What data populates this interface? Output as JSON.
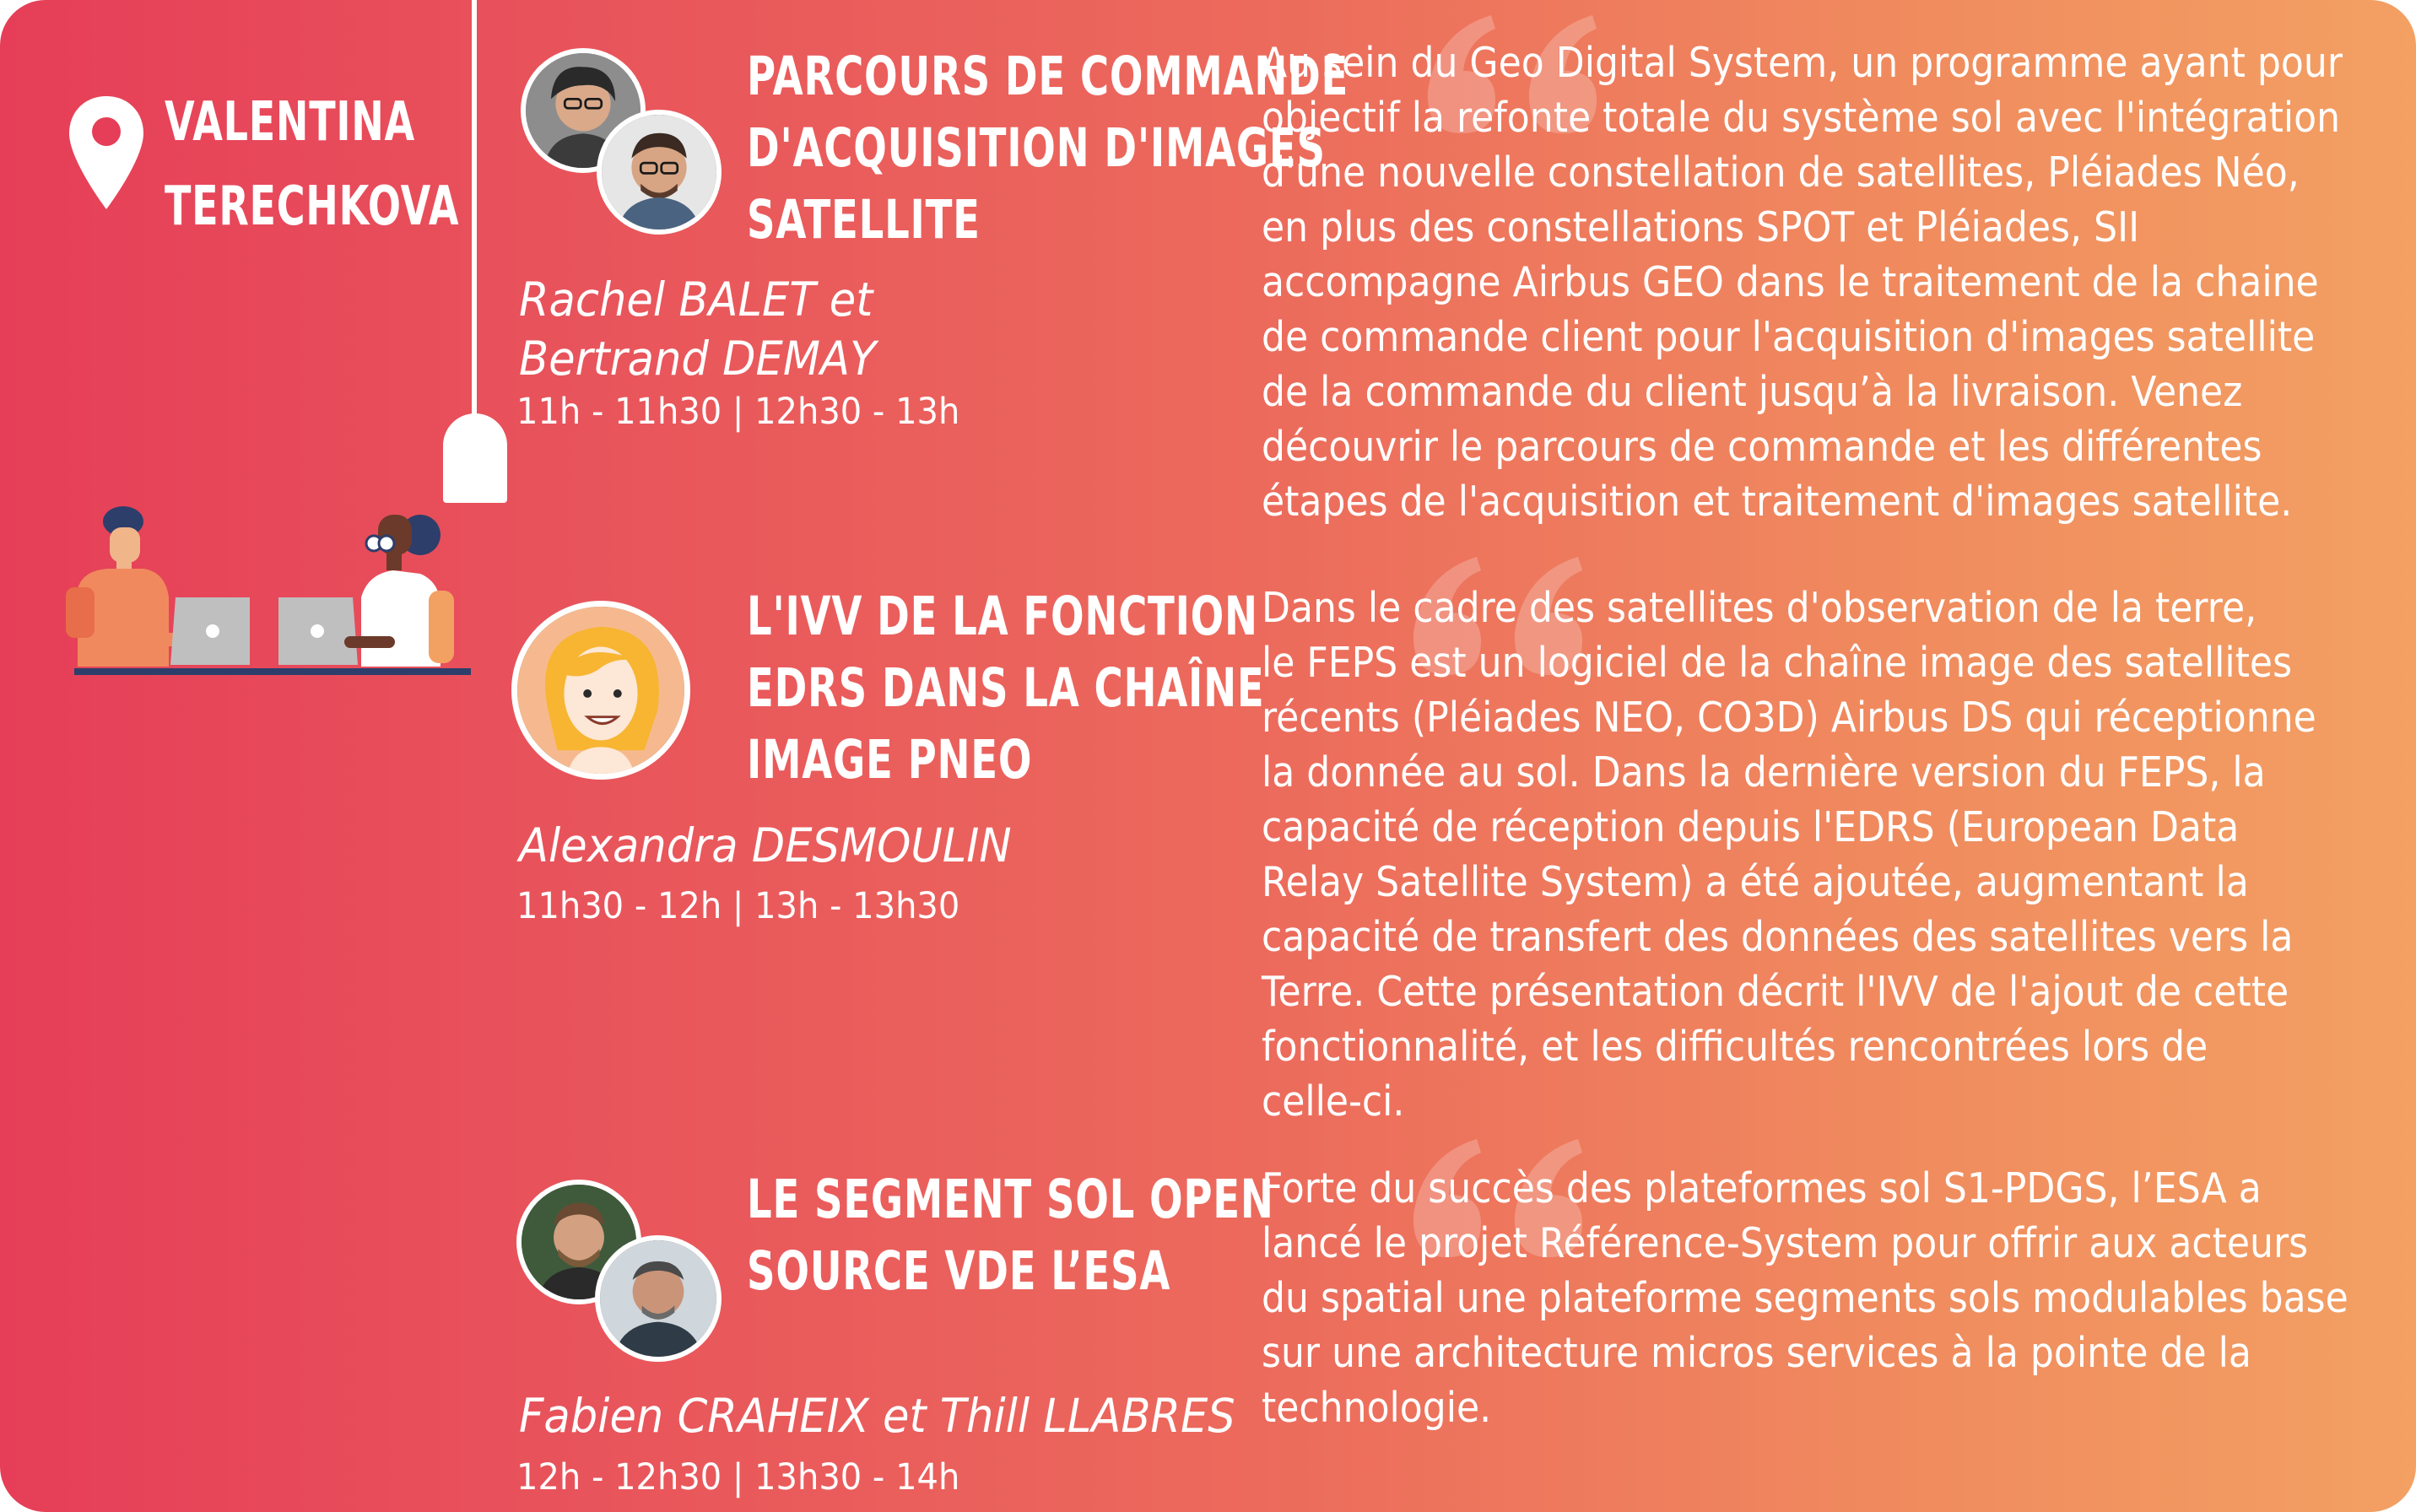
{
  "room": {
    "name_lines": [
      "VALENTINA",
      "TERECHKOVA"
    ],
    "icon": "location-pin-icon"
  },
  "colors": {
    "gradient_start": "#e63e58",
    "gradient_end": "#f3a063",
    "text": "#ffffff"
  },
  "talks": [
    {
      "title_lines": [
        "PARCOURS DE COMMANDE",
        "D'ACQUISITION D'IMAGES",
        "SATELLITE"
      ],
      "speaker_lines": [
        "Rachel BALET et",
        "Bertrand DEMAY"
      ],
      "times": "11h - 11h30  |  12h30 - 13h",
      "description_lines": [
        "Au sein du Geo Digital System, un programme ayant pour",
        "objectif la refonte totale du système sol avec l'intégration",
        "d'une nouvelle constellation de satellites, Pléiades Néo,",
        "en plus des constellations SPOT et Pléiades, SII",
        "accompagne Airbus GEO dans le traitement de la chaine",
        "de commande client pour l'acquisition d'images satellite",
        "de la commande du client jusqu’à la livraison. Venez",
        "découvrir le parcours de commande et les différentes",
        "étapes de l'acquisition et traitement d'images satellite."
      ]
    },
    {
      "title_lines": [
        "L'IVV DE LA FONCTION",
        "EDRS DANS LA CHAÎNE",
        "IMAGE PNEO"
      ],
      "speaker_lines": [
        "Alexandra DESMOULIN"
      ],
      "times": "11h30 - 12h  |  13h - 13h30",
      "description_lines": [
        "Dans le cadre des satellites d'observation de la terre,",
        "le FEPS est un logiciel de la chaîne image des satellites",
        "récents (Pléiades NEO, CO3D) Airbus DS qui réceptionne",
        "la donnée au sol. Dans la dernière version du FEPS, la",
        "capacité de réception depuis l'EDRS (European Data",
        "Relay Satellite System) a été ajoutée, augmentant la",
        "capacité de transfert des données des satellites vers la",
        "Terre. Cette présentation décrit l'IVV de l'ajout de cette",
        "fonctionnalité, et les difficultés rencontrées lors de",
        "celle-ci."
      ]
    },
    {
      "title_lines": [
        "LE SEGMENT SOL OPEN",
        "SOURCE VDE L’ESA"
      ],
      "speaker_lines": [
        "Fabien CRAHEIX et Thill LLABRES"
      ],
      "times": "12h - 12h30  |  13h30 - 14h",
      "description_lines": [
        "Forte du succès des plateformes sol S1-PDGS, l’ESA a",
        "lancé le projet Référence-System pour offrir aux acteurs",
        "du spatial une plateforme segments sols modulables base",
        "sur une architecture micros services à la pointe de la",
        "technologie."
      ]
    }
  ]
}
